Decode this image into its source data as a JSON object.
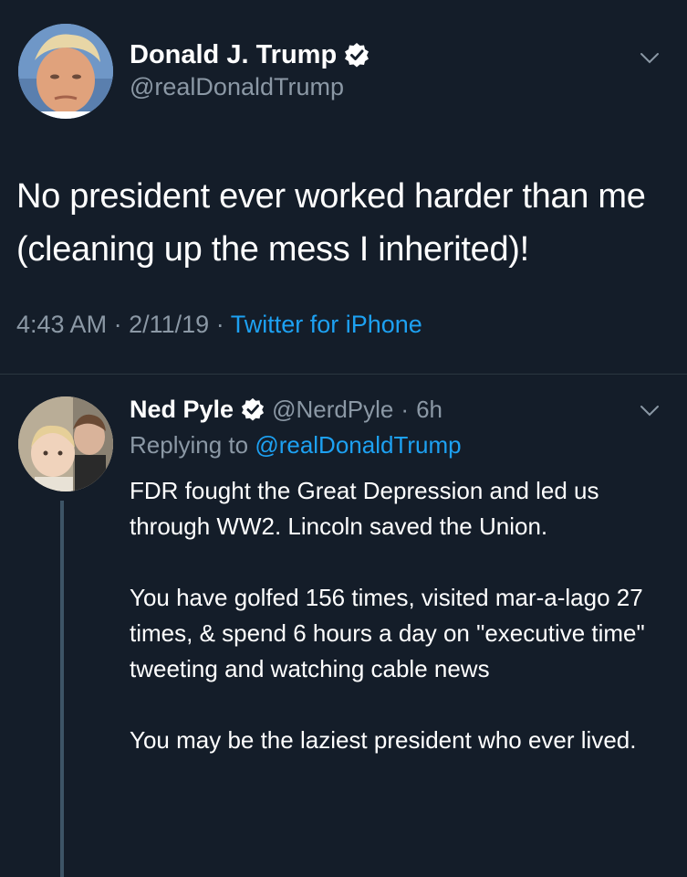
{
  "main_tweet": {
    "author": {
      "display_name": "Donald J. Trump",
      "handle": "@realDonaldTrump",
      "verified": true
    },
    "text": "No president ever worked harder than me (cleaning up the mess I inherited)!",
    "time": "4:43 AM",
    "separator": "·",
    "date": "2/11/19",
    "source": "Twitter for iPhone"
  },
  "reply": {
    "author": {
      "display_name": "Ned Pyle",
      "handle": "@NerdPyle",
      "verified": true
    },
    "time_ago": "6h",
    "separator": "·",
    "replying_prefix": "Replying to",
    "replying_to": "@realDonaldTrump",
    "paragraphs": [
      "FDR fought the Great Depression  and led us through WW2. Lincoln saved the Union.",
      "You have golfed 156 times, visited mar-a-lago 27 times, & spend 6 hours a day on \"executive time\" tweeting and watching cable news",
      "You may be the laziest president who ever lived."
    ]
  },
  "colors": {
    "background": "#141d29",
    "text": "#ffffff",
    "secondary_text": "#8b98a5",
    "link": "#1da1f2",
    "divider": "#2b3640"
  },
  "icons": {
    "verified": "verified-badge-icon",
    "menu": "chevron-down-icon"
  }
}
